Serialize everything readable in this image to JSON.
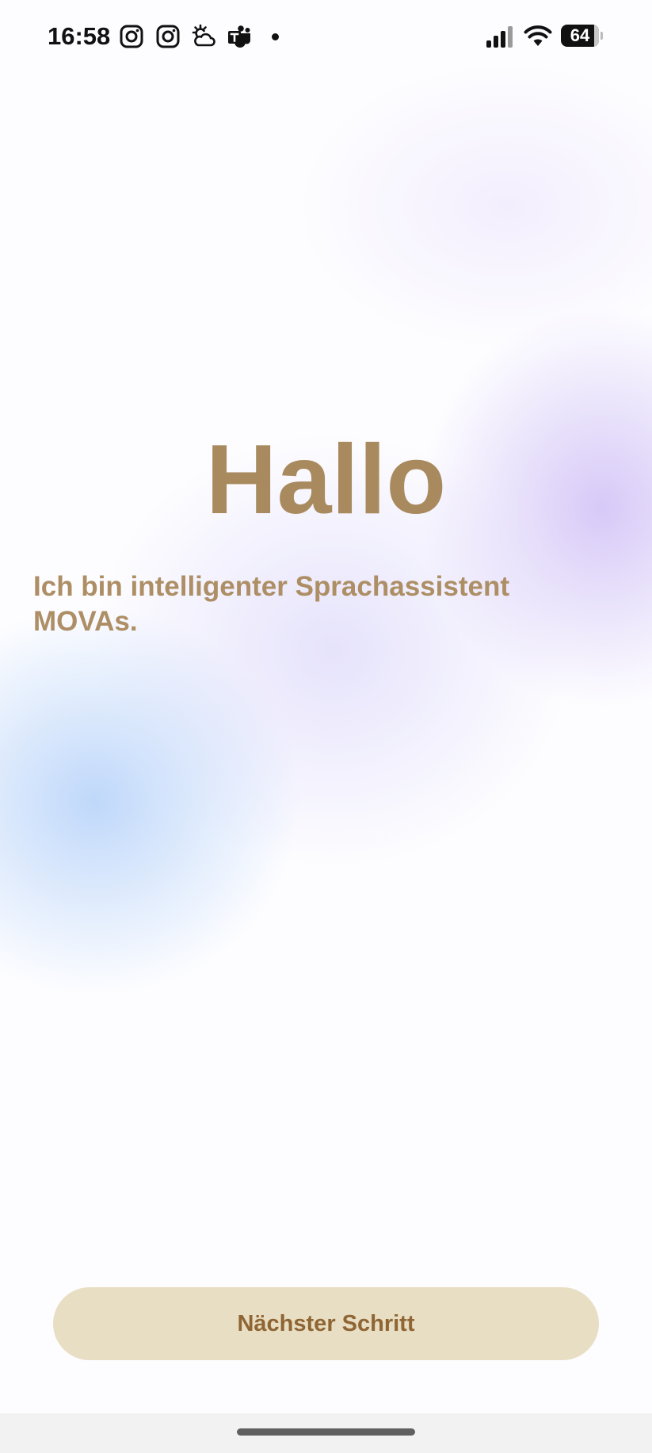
{
  "status_bar": {
    "time": "16:58",
    "notification_icons": [
      "instagram-icon",
      "instagram-icon",
      "weather-icon",
      "teams-icon",
      "notification-dot"
    ],
    "battery_level": "64",
    "battery_fraction": 0.64,
    "signal_icon": "signal-icon",
    "wifi_icon": "wifi-icon"
  },
  "main": {
    "title": "Hallo",
    "intro_text": "Ich bin intelligenter Sprachassistent MOVAs."
  },
  "footer": {
    "next_button_label": "Nächster Schritt"
  },
  "colors": {
    "title": "#a88a5e",
    "intro_text": "#ad8e65",
    "button_background": "#e8dec3",
    "button_text": "#8f6534",
    "gradient_purple": "#d0c0f6",
    "gradient_blue": "#bcd6fa"
  }
}
